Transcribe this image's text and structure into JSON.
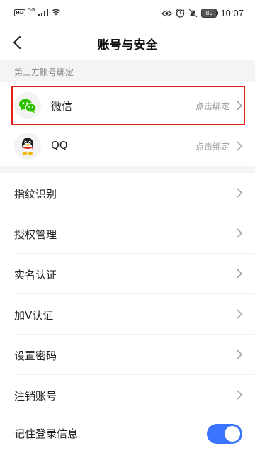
{
  "status_bar": {
    "hd": "HD",
    "network": "5G",
    "battery": "89",
    "time": "10:07"
  },
  "header": {
    "title": "账号与安全"
  },
  "third_party": {
    "section_title": "第三方账号绑定",
    "items": [
      {
        "label": "微信",
        "action": "点击绑定",
        "icon": "wechat-icon"
      },
      {
        "label": "QQ",
        "action": "点击绑定",
        "icon": "qq-icon"
      }
    ]
  },
  "settings": {
    "items": [
      {
        "label": "指纹识别"
      },
      {
        "label": "授权管理"
      },
      {
        "label": "实名认证"
      },
      {
        "label": "加V认证"
      },
      {
        "label": "设置密码"
      },
      {
        "label": "注销账号"
      }
    ],
    "remember_login": {
      "label": "记住登录信息",
      "enabled": true
    }
  },
  "colors": {
    "accent": "#3b74ff",
    "highlight": "#e0201a",
    "wechat_green": "#2dc100"
  }
}
